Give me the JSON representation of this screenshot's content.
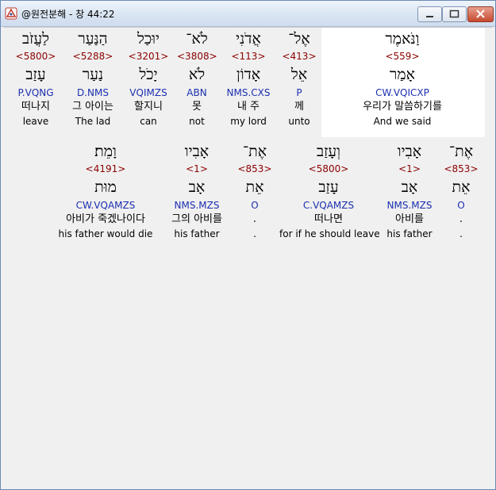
{
  "window": {
    "title": "@원전분해 - 창 44:22"
  },
  "rows": [
    [
      {
        "heb": "וַנֹּאמֶר",
        "strong": "<559>",
        "lex": "אָמַר",
        "parse": "CW.VQICXP",
        "kor": "우리가 말씀하기를",
        "eng": "And we said"
      },
      {
        "heb": "אֶל־",
        "strong": "<413>",
        "lex": "אֵל",
        "parse": "P",
        "kor": "께",
        "eng": "unto"
      },
      {
        "heb": "אֲדֹנִי",
        "strong": "<113>",
        "lex": "אָדוֹן",
        "parse": "NMS.CXS",
        "kor": "내 주",
        "eng": "my lord"
      },
      {
        "heb": "לֹא־",
        "strong": "<3808>",
        "lex": "לֹא",
        "parse": "ABN",
        "kor": "못",
        "eng": "not"
      },
      {
        "heb": "יוּכַל",
        "strong": "<3201>",
        "lex": "יָכֹל",
        "parse": "VQIMZS",
        "kor": "할지니",
        "eng": "can"
      },
      {
        "heb": "הַנַּעַר",
        "strong": "<5288>",
        "lex": "נַעַר",
        "parse": "D.NMS",
        "kor": "그 아이는",
        "eng": "The lad"
      },
      {
        "heb": "לַעֲזֹב",
        "strong": "<5800>",
        "lex": "עָזַב",
        "parse": "P.VQNG",
        "kor": "떠나지",
        "eng": "leave"
      }
    ],
    [
      {
        "heb": "אֶת־",
        "strong": "<853>",
        "lex": "אֵת",
        "parse": "O",
        "kor": ".",
        "eng": "."
      },
      {
        "heb": "אָבִיו",
        "strong": "<1>",
        "lex": "אָב",
        "parse": "NMS.MZS",
        "kor": "아비를",
        "eng": "his father"
      },
      {
        "heb": "וְעָזַב",
        "strong": "<5800>",
        "lex": "עָזַב",
        "parse": "C.VQAMZS",
        "kor": "떠나면",
        "eng": "for if he should leave"
      },
      {
        "heb": "אֶת־",
        "strong": "<853>",
        "lex": "אֵת",
        "parse": "O",
        "kor": ".",
        "eng": "."
      },
      {
        "heb": "אָבִיו",
        "strong": "<1>",
        "lex": "אָב",
        "parse": "NMS.MZS",
        "kor": "그의 아비를",
        "eng": "his father"
      },
      {
        "heb": "וָמֵת׃",
        "strong": "<4191>",
        "lex": "מוּת",
        "parse": "CW.VQAMZS",
        "kor": "아비가 죽겠나이다",
        "eng": "his father would die"
      }
    ]
  ],
  "colors": {
    "strong": "#8b0000",
    "parse": "#1b2fb0",
    "highlight": "#ffffff"
  }
}
